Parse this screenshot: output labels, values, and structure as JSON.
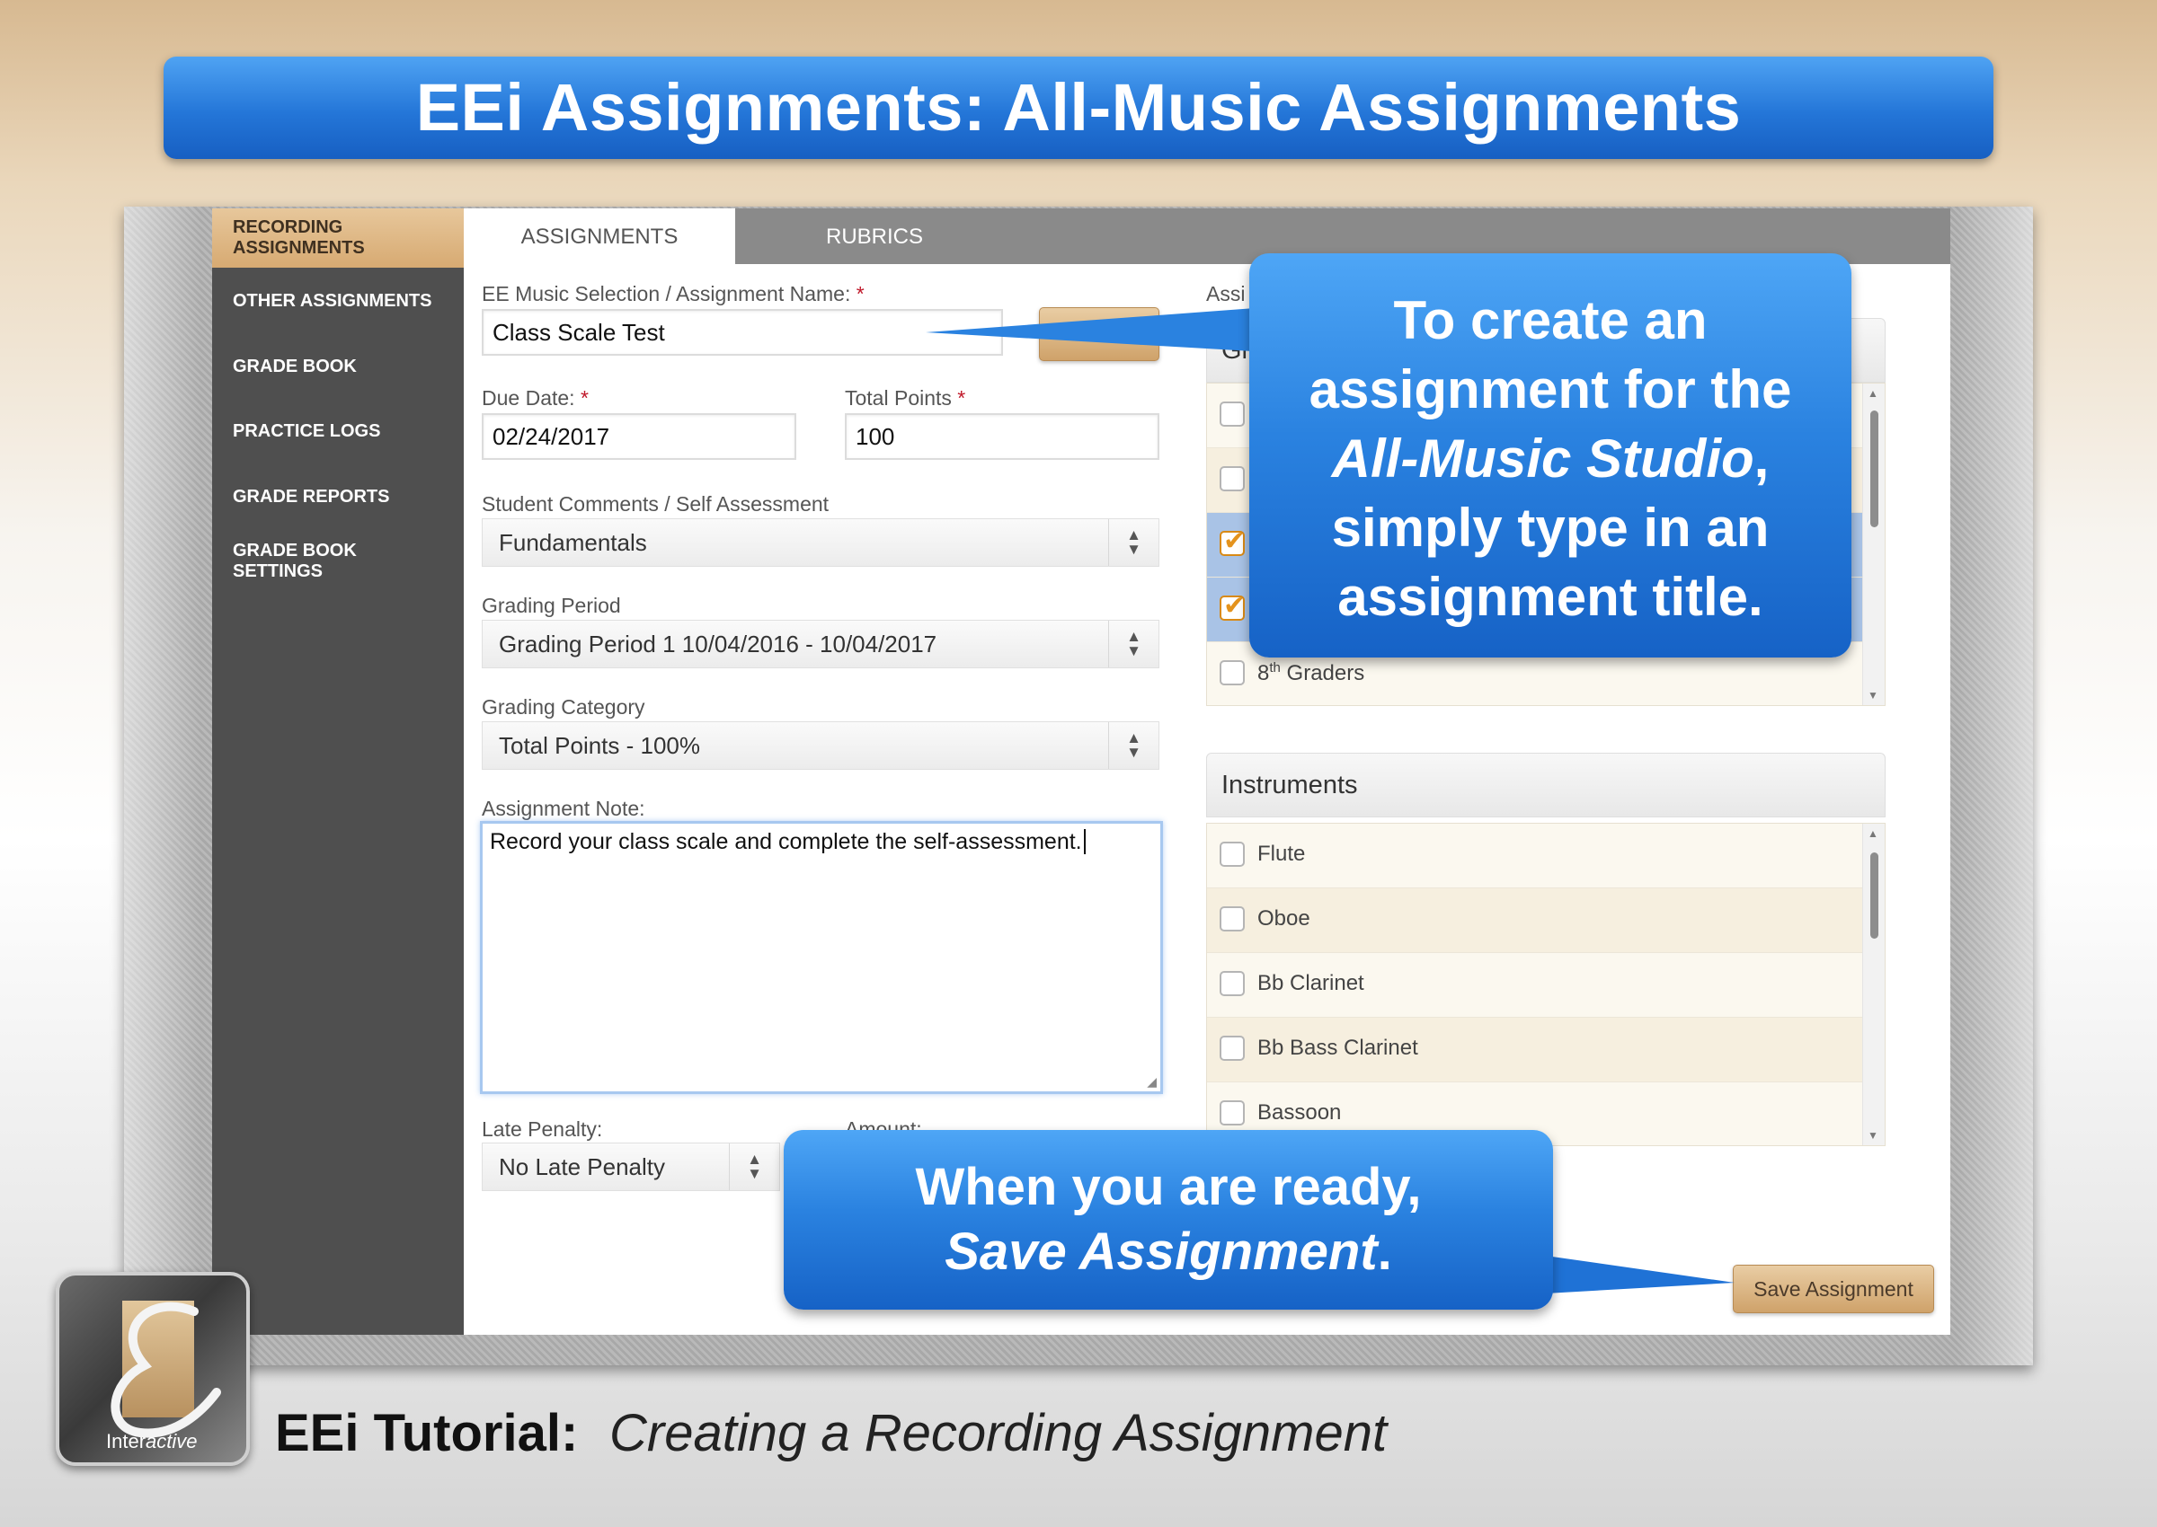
{
  "banner": {
    "title": "EEi Assignments: All-Music Assignments"
  },
  "sidebar": {
    "items": [
      {
        "label_line1": "RECORDING",
        "label_line2": "ASSIGNMENTS",
        "active": true
      },
      {
        "label": "OTHER ASSIGNMENTS"
      },
      {
        "label": "GRADE BOOK"
      },
      {
        "label": "PRACTICE LOGS"
      },
      {
        "label": "GRADE REPORTS"
      },
      {
        "label_line1": "GRADE BOOK",
        "label_line2": "SETTINGS"
      }
    ]
  },
  "tabs": [
    {
      "label": "ASSIGNMENTS",
      "active": true
    },
    {
      "label": "RUBRICS",
      "active": false
    }
  ],
  "form": {
    "name_label": "EE Music Selection / Assignment Name:",
    "name_value": "Class Scale Test",
    "due_label": "Due Date:",
    "due_value": "02/24/2017",
    "points_label": "Total Points",
    "points_value": "100",
    "comments_label": "Student Comments / Self Assessment",
    "comments_value": "Fundamentals",
    "period_label": "Grading Period",
    "period_value": "Grading Period 1 10/04/2016 - 10/04/2017",
    "category_label": "Grading Category",
    "category_value": "Total Points - 100%",
    "note_label": "Assignment Note:",
    "note_value": "Record your class scale and complete the self-assessment.",
    "late_label": "Late Penalty:",
    "late_value": "No Late Penalty",
    "amount_label": "Amount:",
    "required_mark": "*"
  },
  "assign_panel": {
    "label_partial": "Assi",
    "head_partial": "Gr",
    "rows": [
      {
        "checked": false
      },
      {
        "checked": false
      },
      {
        "checked": true
      },
      {
        "checked": true
      },
      {
        "checked": false,
        "label_num": "8",
        "label_sup": "th",
        "label_rest": " Graders"
      }
    ]
  },
  "instruments_panel": {
    "title": "Instruments",
    "items": [
      "Flute",
      "Oboe",
      "Bb Clarinet",
      "Bb Bass Clarinet",
      "Bassoon"
    ]
  },
  "buttons": {
    "save": "Save Assignment"
  },
  "callouts": {
    "create_l1": "To create an",
    "create_l2": "assignment for the",
    "create_l3_italic": "All-Music Studio",
    "create_l3_rest": ",",
    "create_l4": "simply type in an",
    "create_l5": "assignment title.",
    "ready_l1": "When you are ready,",
    "ready_l2_italic": "Save Assignment",
    "ready_l2_rest": "."
  },
  "footer": {
    "bold": "EEi Tutorial:",
    "italic": "Creating a Recording Assignment"
  },
  "logo": {
    "text_inter": "Inter",
    "text_active": "active",
    "icon": "eei-logo-icon"
  },
  "colors": {
    "accent_blue": "#2a82e0",
    "gold": "#d7aa72",
    "sidebar": "#4f4f4f"
  }
}
